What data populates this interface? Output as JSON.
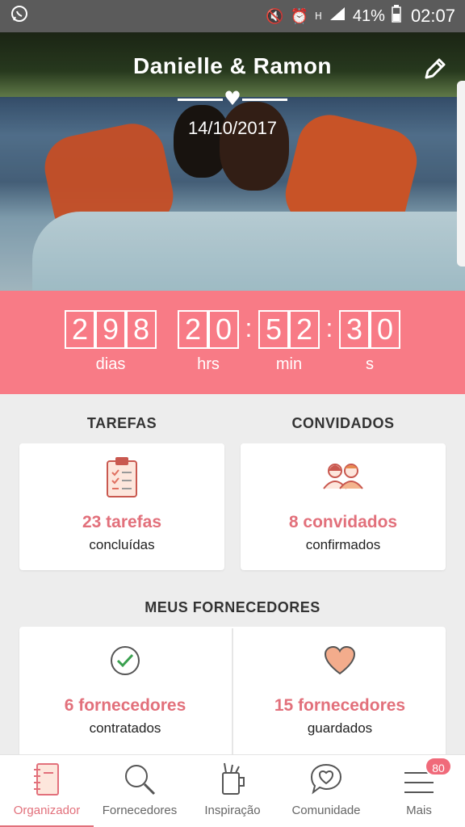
{
  "status_bar": {
    "battery_percent": "41%",
    "time": "02:07",
    "icons": [
      "whatsapp-icon",
      "mute-icon",
      "alarm-icon",
      "hd-signal-icon",
      "signal-icon",
      "battery-icon"
    ]
  },
  "header": {
    "couple_name": "Danielle & Ramon",
    "wedding_date": "14/10/2017",
    "edit_icon": "pencil-icon"
  },
  "countdown": {
    "days_digits": [
      "2",
      "9",
      "8"
    ],
    "hours_digits": [
      "2",
      "0"
    ],
    "minutes_digits": [
      "5",
      "2"
    ],
    "seconds_digits": [
      "3",
      "0"
    ],
    "separator": ":",
    "labels": {
      "days": "dias",
      "hours": "hrs",
      "minutes": "min",
      "seconds": "s"
    }
  },
  "tasks": {
    "title": "TAREFAS",
    "count_text": "23 tarefas",
    "status_text": "concluídas",
    "icon": "clipboard-checklist-icon"
  },
  "guests": {
    "title": "CONVIDADOS",
    "count_text": "8 convidados",
    "status_text": "confirmados",
    "icon": "guests-couple-icon"
  },
  "vendors": {
    "title": "MEUS FORNECEDORES",
    "hired": {
      "count_text": "6 fornecedores",
      "status_text": "contratados",
      "icon": "check-circle-icon"
    },
    "saved": {
      "count_text": "15 fornecedores",
      "status_text": "guardados",
      "icon": "heart-icon"
    }
  },
  "bottom_nav": {
    "items": [
      {
        "label": "Organizador",
        "icon": "notebook-icon",
        "active": true
      },
      {
        "label": "Fornecedores",
        "icon": "search-icon",
        "active": false
      },
      {
        "label": "Inspiração",
        "icon": "inspiration-cup-icon",
        "active": false
      },
      {
        "label": "Comunidade",
        "icon": "chat-heart-icon",
        "active": false
      },
      {
        "label": "Mais",
        "icon": "menu-icon",
        "active": false,
        "badge": "80"
      }
    ]
  },
  "colors": {
    "accent": "#e2707b",
    "countdown_bg": "#f87b86",
    "background": "#ededed",
    "status_bar": "#5b5b5b"
  }
}
